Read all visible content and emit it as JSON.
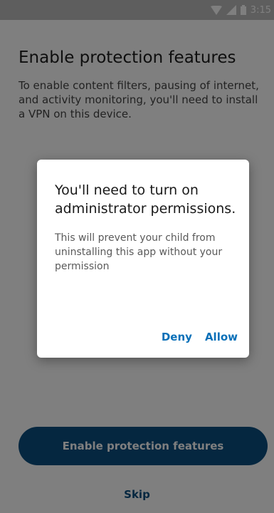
{
  "status_bar": {
    "time": "3:15",
    "icons": [
      "wifi-icon",
      "signal-icon",
      "battery-icon"
    ]
  },
  "page": {
    "title": "Enable protection features",
    "description": "To enable content filters, pausing of internet, and activity monitoring, you'll need to install a VPN on this device.",
    "primary_button_label": "Enable protection features",
    "skip_label": "Skip"
  },
  "dialog": {
    "title": "You'll need to turn on administrator permissions.",
    "message": "This will prevent your child from uninstalling this app without your permission",
    "deny_label": "Deny",
    "allow_label": "Allow"
  },
  "colors": {
    "primary": "#0a4e80",
    "dialog_action": "#0a70b8",
    "status_bar": "#bdbdbd"
  }
}
